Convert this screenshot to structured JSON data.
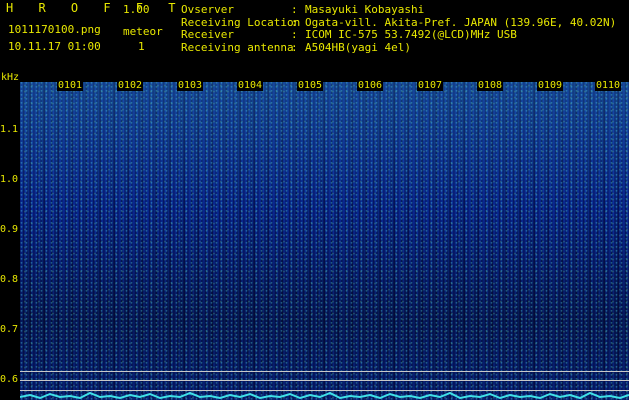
{
  "header": {
    "app_title": "H R O F F T",
    "version": "1.00",
    "file_name": "1011170100.png",
    "meteor_label": "meteor",
    "date_time": "10.11.17 01:00",
    "meteor_count": "1"
  },
  "info": {
    "rows": [
      {
        "key": "Ovserver",
        "value": "Masayuki Kobayashi"
      },
      {
        "key": "Receiving Location",
        "value": "Ogata-vill. Akita-Pref. JAPAN (139.96E, 40.02N)"
      },
      {
        "key": "Receiver",
        "value": "ICOM IC-575 53.7492(@LCD)MHz USB"
      },
      {
        "key": "Receiving antenna",
        "value": "A504HB(yagi 4el)"
      }
    ],
    "separator": ":"
  },
  "axes": {
    "y_unit": "kHz",
    "y_ticks": [
      "1.1",
      "1.0",
      "0.9",
      "0.8",
      "0.7",
      "0.6"
    ],
    "x_ticks": [
      "0101",
      "0102",
      "0103",
      "0104",
      "0105",
      "0106",
      "0107",
      "0108",
      "0109",
      "0110"
    ]
  },
  "colors": {
    "text": "#e8e800",
    "background": "#000000",
    "spectrogram_base": "#0a2a9c",
    "signal": "#40e0e8"
  }
}
